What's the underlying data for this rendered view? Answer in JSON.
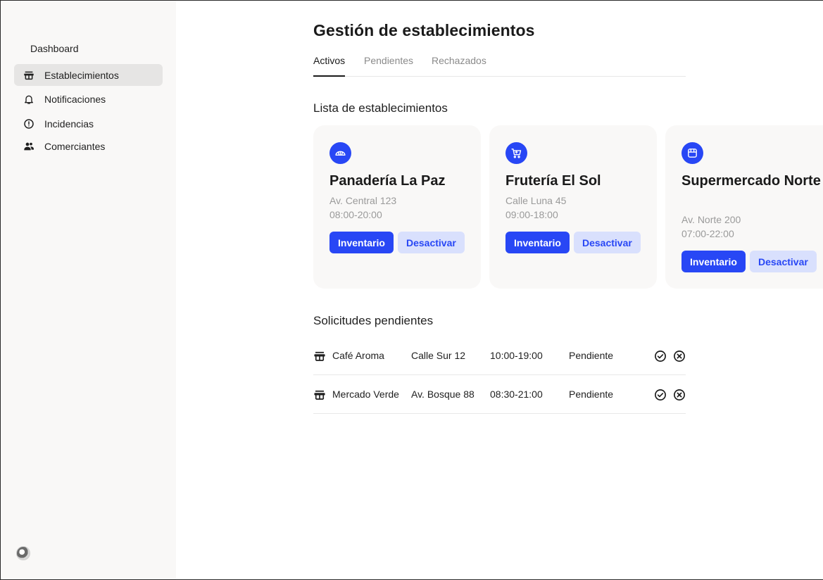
{
  "sidebar": {
    "dashboard_label": "Dashboard",
    "items": [
      {
        "label": "Establecimientos",
        "icon": "store-icon",
        "active": true
      },
      {
        "label": "Notificaciones",
        "icon": "bell-icon",
        "active": false
      },
      {
        "label": "Incidencias",
        "icon": "alert-circle-icon",
        "active": false
      },
      {
        "label": "Comerciantes",
        "icon": "users-icon",
        "active": false
      }
    ]
  },
  "header": {
    "title": "Gestión de establecimientos"
  },
  "tabs": [
    {
      "label": "Activos",
      "active": true
    },
    {
      "label": "Pendientes",
      "active": false
    },
    {
      "label": "Rechazados",
      "active": false
    }
  ],
  "establishments": {
    "section_title": "Lista de establecimientos",
    "cards": [
      {
        "icon": "bread-icon",
        "name": "Panadería La Paz",
        "address": "Av. Central 123",
        "hours": "08:00-20:00",
        "primary_label": "Inventario",
        "secondary_label": "Desactivar"
      },
      {
        "icon": "cart-icon",
        "name": "Frutería El Sol",
        "address": "Calle Luna 45",
        "hours": "09:00-18:00",
        "primary_label": "Inventario",
        "secondary_label": "Desactivar"
      },
      {
        "icon": "storefront-icon",
        "name": "Supermercado Norte",
        "address": "Av. Norte 200",
        "hours": "07:00-22:00",
        "primary_label": "Inventario",
        "secondary_label": "Desactivar"
      }
    ]
  },
  "requests": {
    "section_title": "Solicitudes pendientes",
    "rows": [
      {
        "icon": "store-icon",
        "name": "Café Aroma",
        "address": "Calle Sur 12",
        "hours": "10:00-19:00",
        "status": "Pendiente"
      },
      {
        "icon": "store-icon",
        "name": "Mercado Verde",
        "address": "Av. Bosque 88",
        "hours": "08:30-21:00",
        "status": "Pendiente"
      }
    ]
  },
  "colors": {
    "accent": "#2847f5",
    "accent_soft": "#d9e0fd",
    "sidebar_bg": "#f9f8f7",
    "active_nav_bg": "#e6e5e4"
  }
}
